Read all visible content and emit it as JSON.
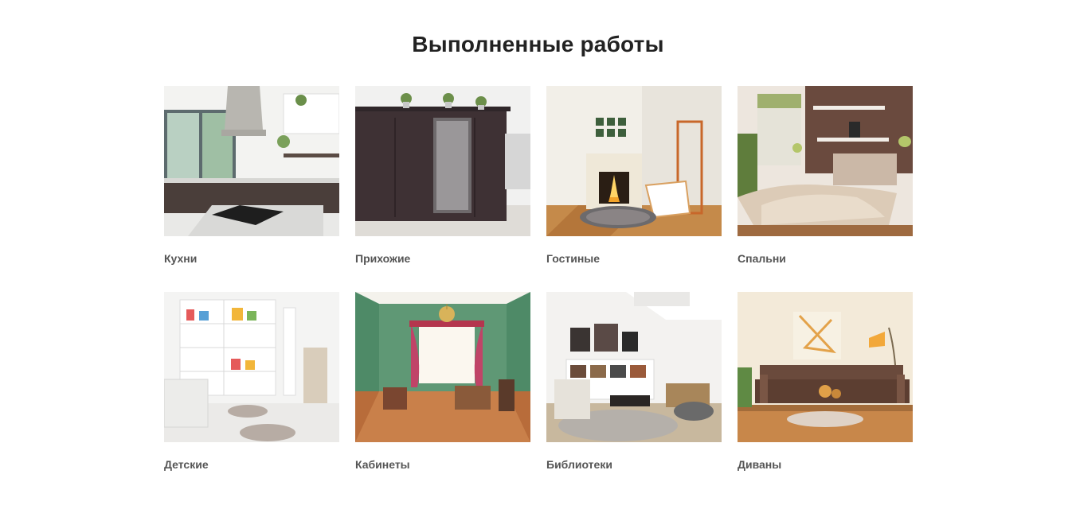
{
  "section": {
    "title": "Выполненные работы",
    "items": [
      {
        "label": "Кухни",
        "image": "kitchen-photo"
      },
      {
        "label": "Прихожие",
        "image": "hallway-photo"
      },
      {
        "label": "Гостиные",
        "image": "living-room-photo"
      },
      {
        "label": "Спальни",
        "image": "bedroom-photo"
      },
      {
        "label": "Детские",
        "image": "kids-room-photo"
      },
      {
        "label": "Кабинеты",
        "image": "study-photo"
      },
      {
        "label": "Библиотеки",
        "image": "library-photo"
      },
      {
        "label": "Диваны",
        "image": "sofa-photo"
      }
    ]
  }
}
